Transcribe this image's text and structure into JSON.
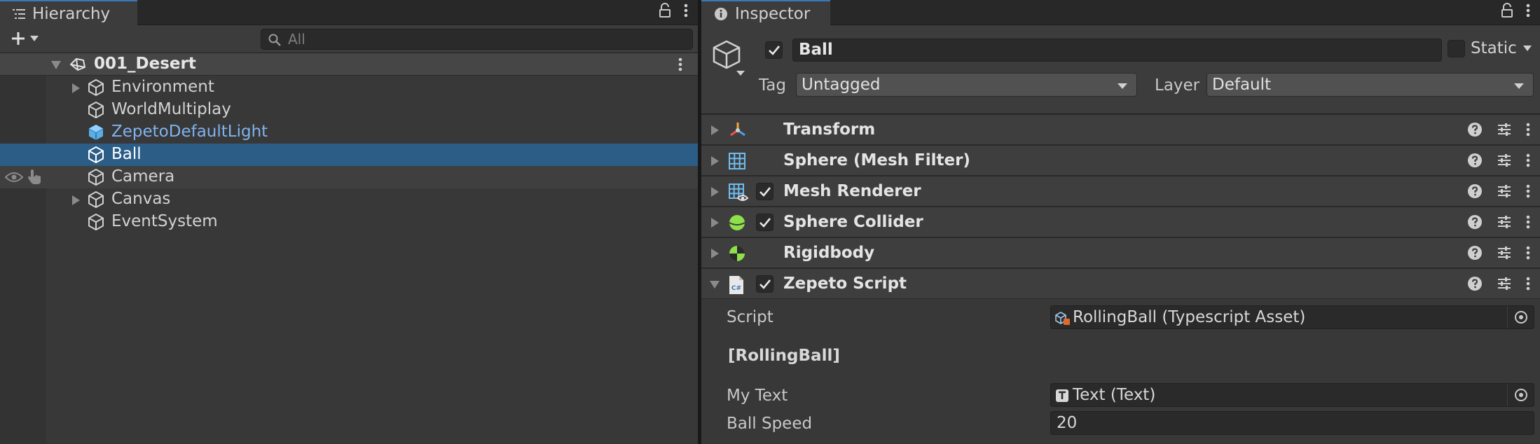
{
  "hierarchy": {
    "tab_title": "Hierarchy",
    "search_placeholder": "All",
    "scene_name": "001_Desert",
    "items": [
      {
        "label": "Environment",
        "expandable": true
      },
      {
        "label": "WorldMultiplay",
        "expandable": false
      },
      {
        "label": "ZepetoDefaultLight",
        "expandable": false,
        "prefab": true
      },
      {
        "label": "Ball",
        "expandable": false,
        "selected": true
      },
      {
        "label": "Camera",
        "expandable": false
      },
      {
        "label": "Canvas",
        "expandable": true
      },
      {
        "label": "EventSystem",
        "expandable": false
      }
    ]
  },
  "inspector": {
    "tab_title": "Inspector",
    "object_name": "Ball",
    "active": true,
    "static_label": "Static",
    "static_checked": false,
    "tag_label": "Tag",
    "tag_value": "Untagged",
    "layer_label": "Layer",
    "layer_value": "Default",
    "components": [
      {
        "name": "Transform",
        "icon": "transform-icon",
        "has_checkbox": false,
        "expanded": false
      },
      {
        "name": "Sphere (Mesh Filter)",
        "icon": "mesh-filter-icon",
        "has_checkbox": false,
        "expanded": false
      },
      {
        "name": "Mesh Renderer",
        "icon": "mesh-renderer-icon",
        "has_checkbox": true,
        "expanded": false
      },
      {
        "name": "Sphere Collider",
        "icon": "sphere-collider-icon",
        "has_checkbox": true,
        "expanded": false
      },
      {
        "name": "Rigidbody",
        "icon": "rigidbody-icon",
        "has_checkbox": false,
        "expanded": false
      },
      {
        "name": "Zepeto Script",
        "icon": "script-icon",
        "has_checkbox": true,
        "expanded": true
      }
    ],
    "zepeto_script": {
      "script_label": "Script",
      "script_value": "RollingBall (Typescript Asset)",
      "section_title": "[RollingBall]",
      "my_text_label": "My Text",
      "my_text_value": "Text (Text)",
      "ball_speed_label": "Ball Speed",
      "ball_speed_value": "20"
    }
  },
  "colors": {
    "selection": "#2c5d87",
    "prefab_text": "#7fb3f0",
    "tab_accent": "#3a79bb"
  }
}
